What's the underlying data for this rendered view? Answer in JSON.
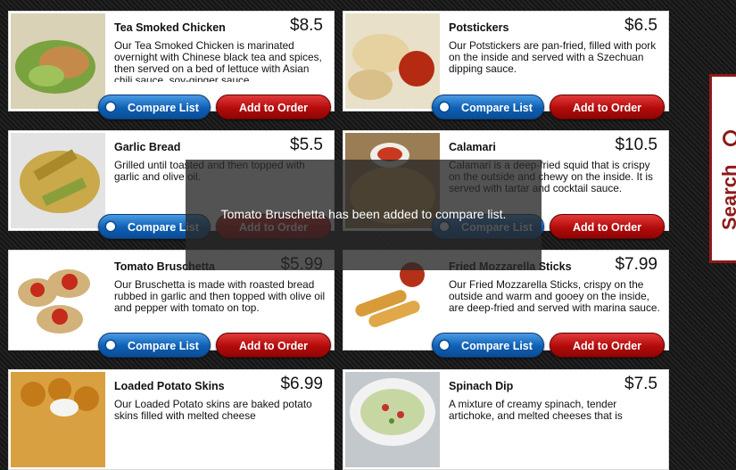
{
  "menu": [
    {
      "name": "Tea Smoked Chicken",
      "price": "$8.5",
      "description": "Our Tea Smoked Chicken is marinated overnight with Chinese black tea and spices, then served on a bed of lettuce with Asian chili sauce, soy-ginger sauce"
    },
    {
      "name": "Potstickers",
      "price": "$6.5",
      "description": "Our Potstickers are pan-fried, filled with pork on the inside and served with a Szechuan dipping sauce."
    },
    {
      "name": "Garlic Bread",
      "price": "$5.5",
      "description": "Grilled until toasted and then topped with garlic and olive oil."
    },
    {
      "name": "Calamari",
      "price": "$10.5",
      "description": "Calamari is a deep-fried squid that is crispy on the outside and chewy on the inside. It is served with tartar and cocktail sauce."
    },
    {
      "name": "Tomato Bruschetta",
      "price": "$5.99",
      "description": "Our Bruschetta is made with roasted bread rubbed in garlic and then topped with olive oil and pepper with tomato on top."
    },
    {
      "name": "Fried Mozzarella Sticks",
      "price": "$7.99",
      "description": "Our Fried Mozzarella Sticks, crispy on the outside and warm and gooey on the inside, are deep-fried and served with marina sauce."
    },
    {
      "name": "Loaded Potato Skins",
      "price": "$6.99",
      "description": "Our Loaded Potato skins are baked potato skins filled with melted cheese"
    },
    {
      "name": "Spinach Dip",
      "price": "$7.5",
      "description": "A mixture of creamy spinach, tender artichoke, and melted cheeses that is"
    }
  ],
  "buttons": {
    "compare_label": "Compare List",
    "order_label": "Add to Order"
  },
  "toast": {
    "message": "Tomato Bruschetta has been added to compare list."
  },
  "search_tab": {
    "label": "Search"
  },
  "colors": {
    "compare_blue": "#0e5fb3",
    "order_red": "#b30a0a",
    "search_red": "#8d1a1a"
  }
}
